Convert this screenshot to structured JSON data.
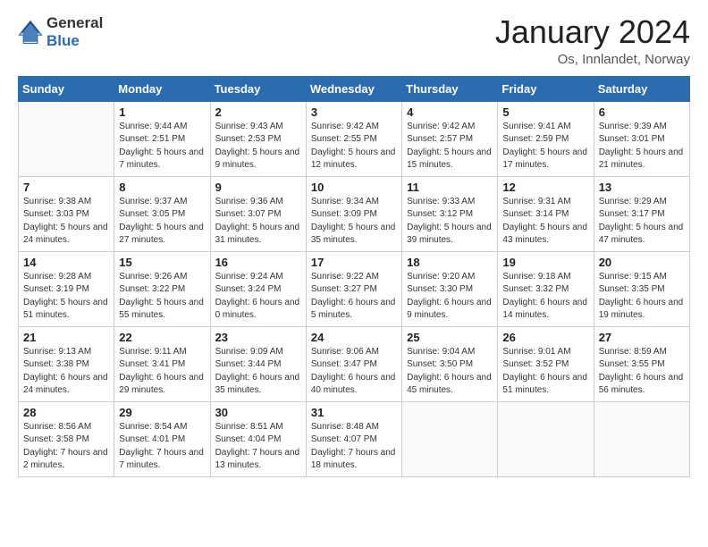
{
  "header": {
    "logo_general": "General",
    "logo_blue": "Blue",
    "title": "January 2024",
    "location": "Os, Innlandet, Norway"
  },
  "weekdays": [
    "Sunday",
    "Monday",
    "Tuesday",
    "Wednesday",
    "Thursday",
    "Friday",
    "Saturday"
  ],
  "rows": [
    [
      {
        "day": null,
        "sunrise": null,
        "sunset": null,
        "daylight": null
      },
      {
        "day": "1",
        "sunrise": "9:44 AM",
        "sunset": "2:51 PM",
        "daylight": "5 hours and 7 minutes."
      },
      {
        "day": "2",
        "sunrise": "9:43 AM",
        "sunset": "2:53 PM",
        "daylight": "5 hours and 9 minutes."
      },
      {
        "day": "3",
        "sunrise": "9:42 AM",
        "sunset": "2:55 PM",
        "daylight": "5 hours and 12 minutes."
      },
      {
        "day": "4",
        "sunrise": "9:42 AM",
        "sunset": "2:57 PM",
        "daylight": "5 hours and 15 minutes."
      },
      {
        "day": "5",
        "sunrise": "9:41 AM",
        "sunset": "2:59 PM",
        "daylight": "5 hours and 17 minutes."
      },
      {
        "day": "6",
        "sunrise": "9:39 AM",
        "sunset": "3:01 PM",
        "daylight": "5 hours and 21 minutes."
      }
    ],
    [
      {
        "day": "7",
        "sunrise": "9:38 AM",
        "sunset": "3:03 PM",
        "daylight": "5 hours and 24 minutes."
      },
      {
        "day": "8",
        "sunrise": "9:37 AM",
        "sunset": "3:05 PM",
        "daylight": "5 hours and 27 minutes."
      },
      {
        "day": "9",
        "sunrise": "9:36 AM",
        "sunset": "3:07 PM",
        "daylight": "5 hours and 31 minutes."
      },
      {
        "day": "10",
        "sunrise": "9:34 AM",
        "sunset": "3:09 PM",
        "daylight": "5 hours and 35 minutes."
      },
      {
        "day": "11",
        "sunrise": "9:33 AM",
        "sunset": "3:12 PM",
        "daylight": "5 hours and 39 minutes."
      },
      {
        "day": "12",
        "sunrise": "9:31 AM",
        "sunset": "3:14 PM",
        "daylight": "5 hours and 43 minutes."
      },
      {
        "day": "13",
        "sunrise": "9:29 AM",
        "sunset": "3:17 PM",
        "daylight": "5 hours and 47 minutes."
      }
    ],
    [
      {
        "day": "14",
        "sunrise": "9:28 AM",
        "sunset": "3:19 PM",
        "daylight": "5 hours and 51 minutes."
      },
      {
        "day": "15",
        "sunrise": "9:26 AM",
        "sunset": "3:22 PM",
        "daylight": "5 hours and 55 minutes."
      },
      {
        "day": "16",
        "sunrise": "9:24 AM",
        "sunset": "3:24 PM",
        "daylight": "6 hours and 0 minutes."
      },
      {
        "day": "17",
        "sunrise": "9:22 AM",
        "sunset": "3:27 PM",
        "daylight": "6 hours and 5 minutes."
      },
      {
        "day": "18",
        "sunrise": "9:20 AM",
        "sunset": "3:30 PM",
        "daylight": "6 hours and 9 minutes."
      },
      {
        "day": "19",
        "sunrise": "9:18 AM",
        "sunset": "3:32 PM",
        "daylight": "6 hours and 14 minutes."
      },
      {
        "day": "20",
        "sunrise": "9:15 AM",
        "sunset": "3:35 PM",
        "daylight": "6 hours and 19 minutes."
      }
    ],
    [
      {
        "day": "21",
        "sunrise": "9:13 AM",
        "sunset": "3:38 PM",
        "daylight": "6 hours and 24 minutes."
      },
      {
        "day": "22",
        "sunrise": "9:11 AM",
        "sunset": "3:41 PM",
        "daylight": "6 hours and 29 minutes."
      },
      {
        "day": "23",
        "sunrise": "9:09 AM",
        "sunset": "3:44 PM",
        "daylight": "6 hours and 35 minutes."
      },
      {
        "day": "24",
        "sunrise": "9:06 AM",
        "sunset": "3:47 PM",
        "daylight": "6 hours and 40 minutes."
      },
      {
        "day": "25",
        "sunrise": "9:04 AM",
        "sunset": "3:50 PM",
        "daylight": "6 hours and 45 minutes."
      },
      {
        "day": "26",
        "sunrise": "9:01 AM",
        "sunset": "3:52 PM",
        "daylight": "6 hours and 51 minutes."
      },
      {
        "day": "27",
        "sunrise": "8:59 AM",
        "sunset": "3:55 PM",
        "daylight": "6 hours and 56 minutes."
      }
    ],
    [
      {
        "day": "28",
        "sunrise": "8:56 AM",
        "sunset": "3:58 PM",
        "daylight": "7 hours and 2 minutes."
      },
      {
        "day": "29",
        "sunrise": "8:54 AM",
        "sunset": "4:01 PM",
        "daylight": "7 hours and 7 minutes."
      },
      {
        "day": "30",
        "sunrise": "8:51 AM",
        "sunset": "4:04 PM",
        "daylight": "7 hours and 13 minutes."
      },
      {
        "day": "31",
        "sunrise": "8:48 AM",
        "sunset": "4:07 PM",
        "daylight": "7 hours and 18 minutes."
      },
      {
        "day": null,
        "sunrise": null,
        "sunset": null,
        "daylight": null
      },
      {
        "day": null,
        "sunrise": null,
        "sunset": null,
        "daylight": null
      },
      {
        "day": null,
        "sunrise": null,
        "sunset": null,
        "daylight": null
      }
    ]
  ],
  "labels": {
    "sunrise_prefix": "Sunrise: ",
    "sunset_prefix": "Sunset: ",
    "daylight_prefix": "Daylight: "
  }
}
